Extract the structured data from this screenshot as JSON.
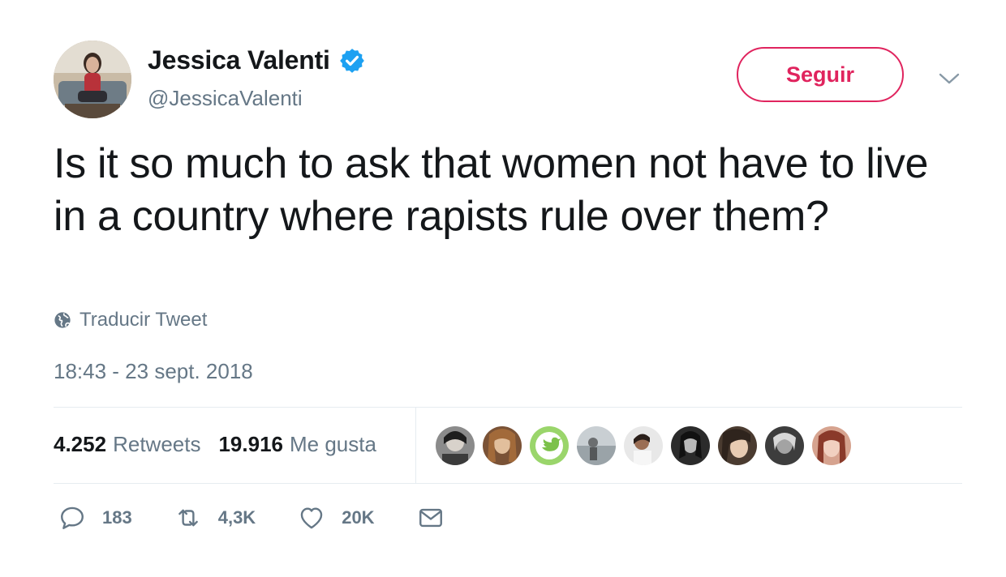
{
  "author": {
    "display_name": "Jessica Valenti",
    "handle": "@JessicaValenti",
    "verified": true,
    "avatar_icon": "profile-photo"
  },
  "follow_button": {
    "label": "Seguir"
  },
  "menu": {
    "icon": "chevron-down-icon"
  },
  "tweet": {
    "text": "Is it so much to ask that women not have to live in a country where rapists rule over them?",
    "translate_label": "Traducir Tweet",
    "timestamp": "18:43 - 23 sept. 2018"
  },
  "stats": {
    "retweets_count": "4.252",
    "retweets_label": "Retweets",
    "likes_count": "19.916",
    "likes_label": "Me gusta"
  },
  "likers": [
    {
      "name": "liker-1"
    },
    {
      "name": "liker-2"
    },
    {
      "name": "liker-3"
    },
    {
      "name": "liker-4"
    },
    {
      "name": "liker-5"
    },
    {
      "name": "liker-6"
    },
    {
      "name": "liker-7"
    },
    {
      "name": "liker-8"
    },
    {
      "name": "liker-9"
    }
  ],
  "actions": {
    "replies": "183",
    "retweets": "4,3K",
    "likes": "20K"
  },
  "colors": {
    "accent": "#e0245e",
    "verified": "#1da1f2",
    "secondary_text": "#657786",
    "divider": "#e6ecf0"
  }
}
